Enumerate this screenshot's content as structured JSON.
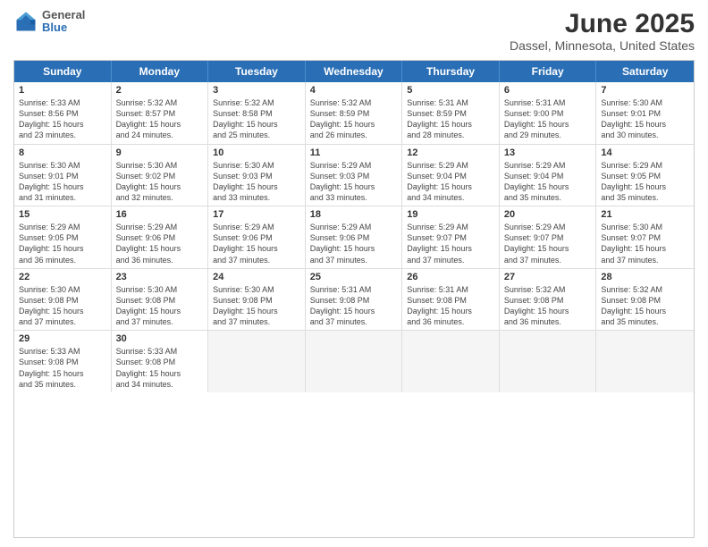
{
  "logo": {
    "general": "General",
    "blue": "Blue"
  },
  "title": "June 2025",
  "subtitle": "Dassel, Minnesota, United States",
  "headers": [
    "Sunday",
    "Monday",
    "Tuesday",
    "Wednesday",
    "Thursday",
    "Friday",
    "Saturday"
  ],
  "weeks": [
    [
      {
        "day": "1",
        "lines": [
          "Sunrise: 5:33 AM",
          "Sunset: 8:56 PM",
          "Daylight: 15 hours",
          "and 23 minutes."
        ]
      },
      {
        "day": "2",
        "lines": [
          "Sunrise: 5:32 AM",
          "Sunset: 8:57 PM",
          "Daylight: 15 hours",
          "and 24 minutes."
        ]
      },
      {
        "day": "3",
        "lines": [
          "Sunrise: 5:32 AM",
          "Sunset: 8:58 PM",
          "Daylight: 15 hours",
          "and 25 minutes."
        ]
      },
      {
        "day": "4",
        "lines": [
          "Sunrise: 5:32 AM",
          "Sunset: 8:59 PM",
          "Daylight: 15 hours",
          "and 26 minutes."
        ]
      },
      {
        "day": "5",
        "lines": [
          "Sunrise: 5:31 AM",
          "Sunset: 8:59 PM",
          "Daylight: 15 hours",
          "and 28 minutes."
        ]
      },
      {
        "day": "6",
        "lines": [
          "Sunrise: 5:31 AM",
          "Sunset: 9:00 PM",
          "Daylight: 15 hours",
          "and 29 minutes."
        ]
      },
      {
        "day": "7",
        "lines": [
          "Sunrise: 5:30 AM",
          "Sunset: 9:01 PM",
          "Daylight: 15 hours",
          "and 30 minutes."
        ]
      }
    ],
    [
      {
        "day": "8",
        "lines": [
          "Sunrise: 5:30 AM",
          "Sunset: 9:01 PM",
          "Daylight: 15 hours",
          "and 31 minutes."
        ]
      },
      {
        "day": "9",
        "lines": [
          "Sunrise: 5:30 AM",
          "Sunset: 9:02 PM",
          "Daylight: 15 hours",
          "and 32 minutes."
        ]
      },
      {
        "day": "10",
        "lines": [
          "Sunrise: 5:30 AM",
          "Sunset: 9:03 PM",
          "Daylight: 15 hours",
          "and 33 minutes."
        ]
      },
      {
        "day": "11",
        "lines": [
          "Sunrise: 5:29 AM",
          "Sunset: 9:03 PM",
          "Daylight: 15 hours",
          "and 33 minutes."
        ]
      },
      {
        "day": "12",
        "lines": [
          "Sunrise: 5:29 AM",
          "Sunset: 9:04 PM",
          "Daylight: 15 hours",
          "and 34 minutes."
        ]
      },
      {
        "day": "13",
        "lines": [
          "Sunrise: 5:29 AM",
          "Sunset: 9:04 PM",
          "Daylight: 15 hours",
          "and 35 minutes."
        ]
      },
      {
        "day": "14",
        "lines": [
          "Sunrise: 5:29 AM",
          "Sunset: 9:05 PM",
          "Daylight: 15 hours",
          "and 35 minutes."
        ]
      }
    ],
    [
      {
        "day": "15",
        "lines": [
          "Sunrise: 5:29 AM",
          "Sunset: 9:05 PM",
          "Daylight: 15 hours",
          "and 36 minutes."
        ]
      },
      {
        "day": "16",
        "lines": [
          "Sunrise: 5:29 AM",
          "Sunset: 9:06 PM",
          "Daylight: 15 hours",
          "and 36 minutes."
        ]
      },
      {
        "day": "17",
        "lines": [
          "Sunrise: 5:29 AM",
          "Sunset: 9:06 PM",
          "Daylight: 15 hours",
          "and 37 minutes."
        ]
      },
      {
        "day": "18",
        "lines": [
          "Sunrise: 5:29 AM",
          "Sunset: 9:06 PM",
          "Daylight: 15 hours",
          "and 37 minutes."
        ]
      },
      {
        "day": "19",
        "lines": [
          "Sunrise: 5:29 AM",
          "Sunset: 9:07 PM",
          "Daylight: 15 hours",
          "and 37 minutes."
        ]
      },
      {
        "day": "20",
        "lines": [
          "Sunrise: 5:29 AM",
          "Sunset: 9:07 PM",
          "Daylight: 15 hours",
          "and 37 minutes."
        ]
      },
      {
        "day": "21",
        "lines": [
          "Sunrise: 5:30 AM",
          "Sunset: 9:07 PM",
          "Daylight: 15 hours",
          "and 37 minutes."
        ]
      }
    ],
    [
      {
        "day": "22",
        "lines": [
          "Sunrise: 5:30 AM",
          "Sunset: 9:08 PM",
          "Daylight: 15 hours",
          "and 37 minutes."
        ]
      },
      {
        "day": "23",
        "lines": [
          "Sunrise: 5:30 AM",
          "Sunset: 9:08 PM",
          "Daylight: 15 hours",
          "and 37 minutes."
        ]
      },
      {
        "day": "24",
        "lines": [
          "Sunrise: 5:30 AM",
          "Sunset: 9:08 PM",
          "Daylight: 15 hours",
          "and 37 minutes."
        ]
      },
      {
        "day": "25",
        "lines": [
          "Sunrise: 5:31 AM",
          "Sunset: 9:08 PM",
          "Daylight: 15 hours",
          "and 37 minutes."
        ]
      },
      {
        "day": "26",
        "lines": [
          "Sunrise: 5:31 AM",
          "Sunset: 9:08 PM",
          "Daylight: 15 hours",
          "and 36 minutes."
        ]
      },
      {
        "day": "27",
        "lines": [
          "Sunrise: 5:32 AM",
          "Sunset: 9:08 PM",
          "Daylight: 15 hours",
          "and 36 minutes."
        ]
      },
      {
        "day": "28",
        "lines": [
          "Sunrise: 5:32 AM",
          "Sunset: 9:08 PM",
          "Daylight: 15 hours",
          "and 35 minutes."
        ]
      }
    ],
    [
      {
        "day": "29",
        "lines": [
          "Sunrise: 5:33 AM",
          "Sunset: 9:08 PM",
          "Daylight: 15 hours",
          "and 35 minutes."
        ]
      },
      {
        "day": "30",
        "lines": [
          "Sunrise: 5:33 AM",
          "Sunset: 9:08 PM",
          "Daylight: 15 hours",
          "and 34 minutes."
        ]
      },
      {
        "day": "",
        "lines": []
      },
      {
        "day": "",
        "lines": []
      },
      {
        "day": "",
        "lines": []
      },
      {
        "day": "",
        "lines": []
      },
      {
        "day": "",
        "lines": []
      }
    ]
  ]
}
